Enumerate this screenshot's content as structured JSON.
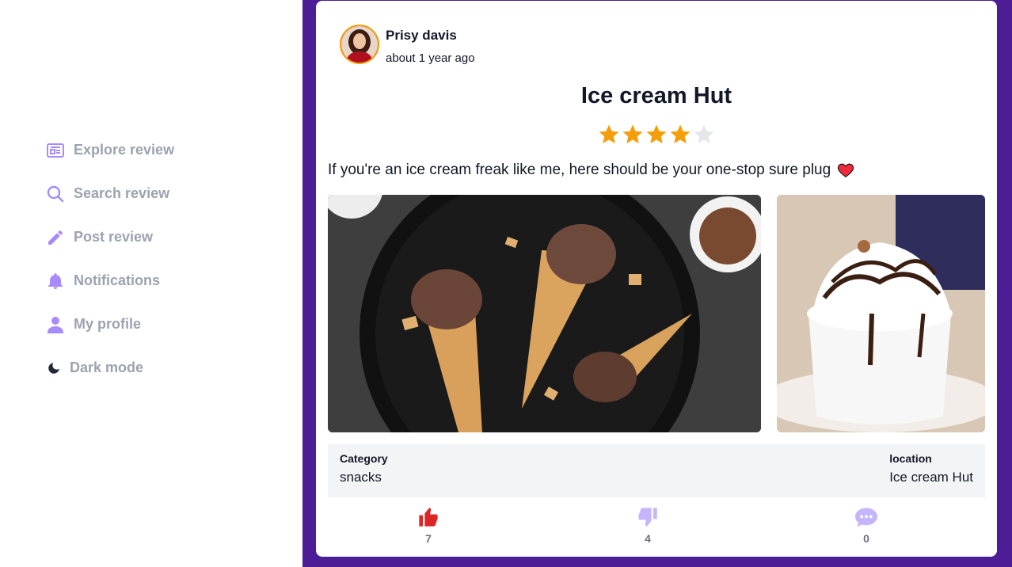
{
  "nav": {
    "items": [
      {
        "label": "Explore review",
        "icon": "newspaper-icon"
      },
      {
        "label": "Search review",
        "icon": "search-icon"
      },
      {
        "label": "Post review",
        "icon": "pencil-icon"
      },
      {
        "label": "Notifications",
        "icon": "bell-icon"
      },
      {
        "label": "My profile",
        "icon": "user-icon"
      },
      {
        "label": "Dark mode",
        "icon": "moon-icon"
      }
    ]
  },
  "post": {
    "author": "Prisy davis",
    "time": "about 1 year ago",
    "title": "Ice cream Hut",
    "rating": 4,
    "rating_max": 5,
    "text": "If you're an ice cream freak like me, here should be your one-stop sure plug",
    "category_label": "Category",
    "category_value": "snacks",
    "location_label": "location",
    "location_value": "Ice cream Hut",
    "likes": "7",
    "dislikes": "4",
    "comments": "0"
  },
  "colors": {
    "accent": "#4c1d95",
    "nav_icon": "#a78bfa",
    "nav_text": "#9ca3af",
    "star_on": "#f59e0b",
    "star_off": "#e5e7eb",
    "like": "#dc2626",
    "dislike": "#c4b5fd"
  }
}
